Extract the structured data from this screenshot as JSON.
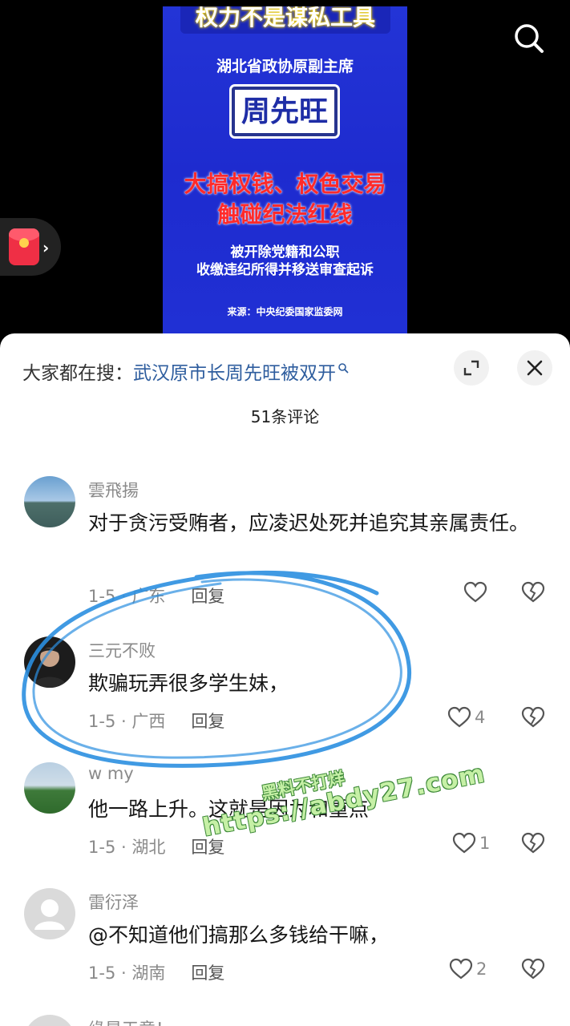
{
  "video": {
    "poster_top_banner": "权力不是谋私工具",
    "poster_subtitle": "湖北省政协原副主席",
    "poster_name": "周先旺",
    "poster_red_line1": "大搞权钱、权色交易",
    "poster_red_line2": "触碰纪法红线",
    "poster_white_line1": "被开除党籍和公职",
    "poster_white_line2": "收缴违纪所得并移送审查起诉",
    "poster_source": "来源：中央纪委国家监委网",
    "search_icon": "search-icon",
    "red_packet_icon": "red-packet-icon",
    "colors": {
      "poster_bg": "#2233d4",
      "poster_red": "#ff2a2a"
    }
  },
  "sheet": {
    "hot_search_label": "大家都在搜：",
    "hot_search_term": "武汉原市长周先旺被双开",
    "expand_icon": "expand-icon",
    "close_icon": "close-icon",
    "comment_count": "51条评论",
    "reply_label": "回复",
    "comments": [
      {
        "username": "雲飛揚",
        "text": "对于贪污受贿者，应凌迟处死并追究其亲属责任。",
        "meta": "1-5 · 广东",
        "likes": ""
      },
      {
        "username": "三元不败",
        "text": "欺骗玩弄很多学生妹，",
        "meta": "1-5 · 广西",
        "likes": "4"
      },
      {
        "username": "w my",
        "text": "他一路上升。这就是因为和重点",
        "meta": "1-5 · 湖北",
        "likes": "1"
      },
      {
        "username": "雷衍泽",
        "text": "@不知道他们搞那么多钱给干嘛，",
        "meta": "1-5 · 湖南",
        "likes": "2"
      },
      {
        "username": "缘是天意！",
        "text": "",
        "meta": "",
        "likes": ""
      }
    ],
    "colors": {
      "link": "#2e5d9e",
      "muted": "#8a8a8a",
      "scribble": "#2b8fe0"
    }
  },
  "watermark": {
    "line1": "黑料不打烊",
    "line2": "https://abdy27.com"
  }
}
